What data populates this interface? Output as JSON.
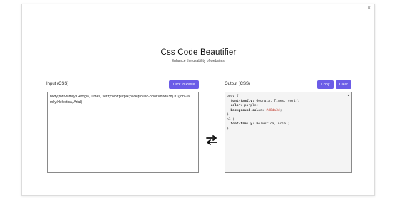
{
  "window": {
    "close_label": "x"
  },
  "header": {
    "title": "Css Code Beautifier",
    "subtitle": "Enhance the usability of websites."
  },
  "input_panel": {
    "label": "Input (CSS)",
    "paste_button_label": "Click to Paste",
    "value": "body{font-family:Georgia, Times, serif;color:purple;background-color:#d8da3d} h1{font-family:Helvetica, Arial}"
  },
  "output_panel": {
    "label": "Output (CSS)",
    "copy_button_label": "Copy",
    "clear_button_label": "Clear",
    "lines": [
      {
        "text": "body {"
      },
      {
        "prop": "  font-family:",
        "val": " Georgia, Times, serif;"
      },
      {
        "prop": "  color:",
        "val": " purple;"
      },
      {
        "prop": "  background-color:",
        "hex": " #d8da3d",
        "end": ";"
      },
      {
        "text": "}"
      },
      {
        "text": "h1 {"
      },
      {
        "prop": "  font-family:",
        "val": " Helvetica, Arial;"
      },
      {
        "text": "}"
      }
    ]
  },
  "icons": {
    "swap": "swap-arrows-icon",
    "scroll_up": "scroll-up-arrow-icon"
  },
  "colors": {
    "accent": "#6b5ce7",
    "hex_value": "#c0392b",
    "output_background": "#f4f4f4"
  }
}
